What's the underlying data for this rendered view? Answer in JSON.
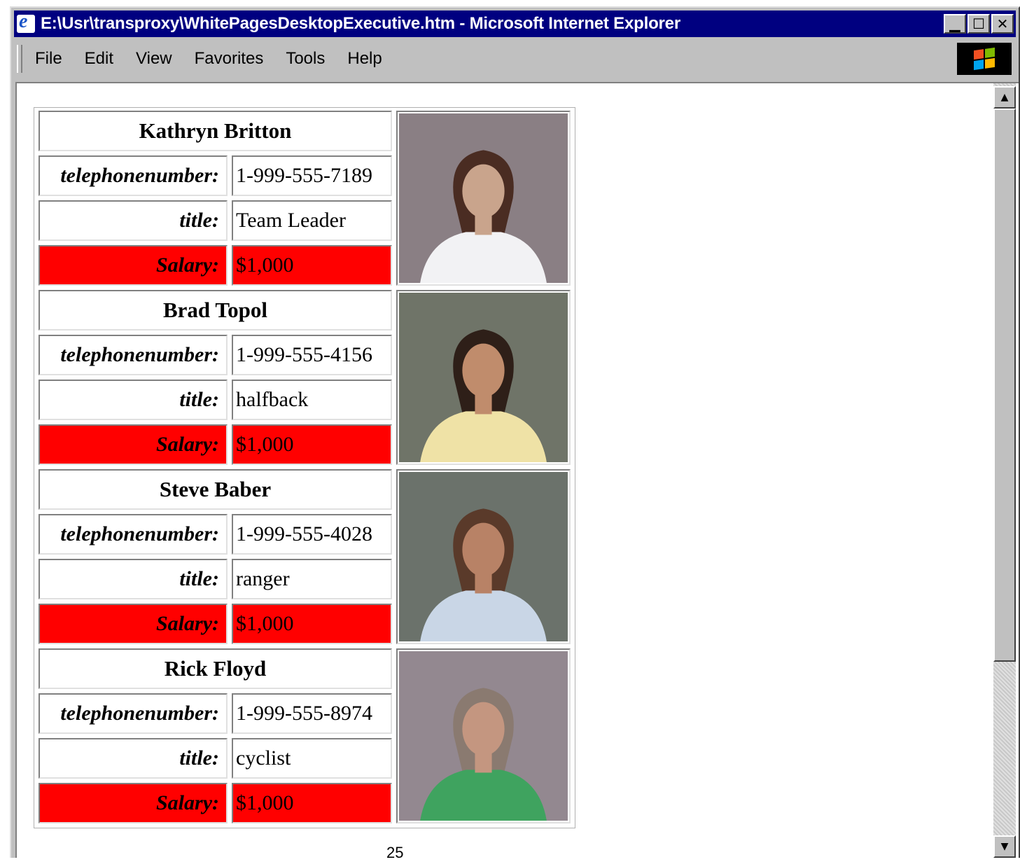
{
  "window": {
    "title": "E:\\Usr\\transproxy\\WhitePagesDesktopExecutive.htm - Microsoft Internet Explorer",
    "buttons": {
      "minimize": "▁",
      "maximize": "☐",
      "close": "✕"
    }
  },
  "menu": {
    "items": [
      {
        "label": "File"
      },
      {
        "label": "Edit"
      },
      {
        "label": "View"
      },
      {
        "label": "Favorites"
      },
      {
        "label": "Tools"
      },
      {
        "label": "Help"
      }
    ]
  },
  "scrollbar": {
    "up_arrow": "▲",
    "down_arrow": "▼"
  },
  "records": [
    {
      "name": "Kathryn Britton",
      "telephone_label": "telephonenumber:",
      "telephone": "1-999-555-7189",
      "title_label": "title:",
      "title": "Team Leader",
      "salary_label": "Salary:",
      "salary": "$1,000",
      "photo": {
        "bg": "#8a7f84",
        "shirt": "#f2f2f4",
        "skin": "#c9a48c",
        "hair": "#4a2c22"
      }
    },
    {
      "name": "Brad Topol",
      "telephone_label": "telephonenumber:",
      "telephone": "1-999-555-4156",
      "title_label": "title:",
      "title": "halfback",
      "salary_label": "Salary:",
      "salary": "$1,000",
      "photo": {
        "bg": "#6f7468",
        "shirt": "#efe2a6",
        "skin": "#c08c6c",
        "hair": "#2e1f18"
      }
    },
    {
      "name": "Steve Baber",
      "telephone_label": "telephonenumber:",
      "telephone": "1-999-555-4028",
      "title_label": "title:",
      "title": "ranger",
      "salary_label": "Salary:",
      "salary": "$1,000",
      "photo": {
        "bg": "#6b726b",
        "shirt": "#c9d6e6",
        "skin": "#b88266",
        "hair": "#5a3a2a"
      }
    },
    {
      "name": "Rick Floyd",
      "telephone_label": "telephonenumber:",
      "telephone": "1-999-555-8974",
      "title_label": "title:",
      "title": "cyclist",
      "salary_label": "Salary:",
      "salary": "$1,000",
      "photo": {
        "bg": "#938890",
        "shirt": "#3fa35f",
        "skin": "#c49680",
        "hair": "#8a7a70"
      }
    }
  ],
  "page_number": "25"
}
